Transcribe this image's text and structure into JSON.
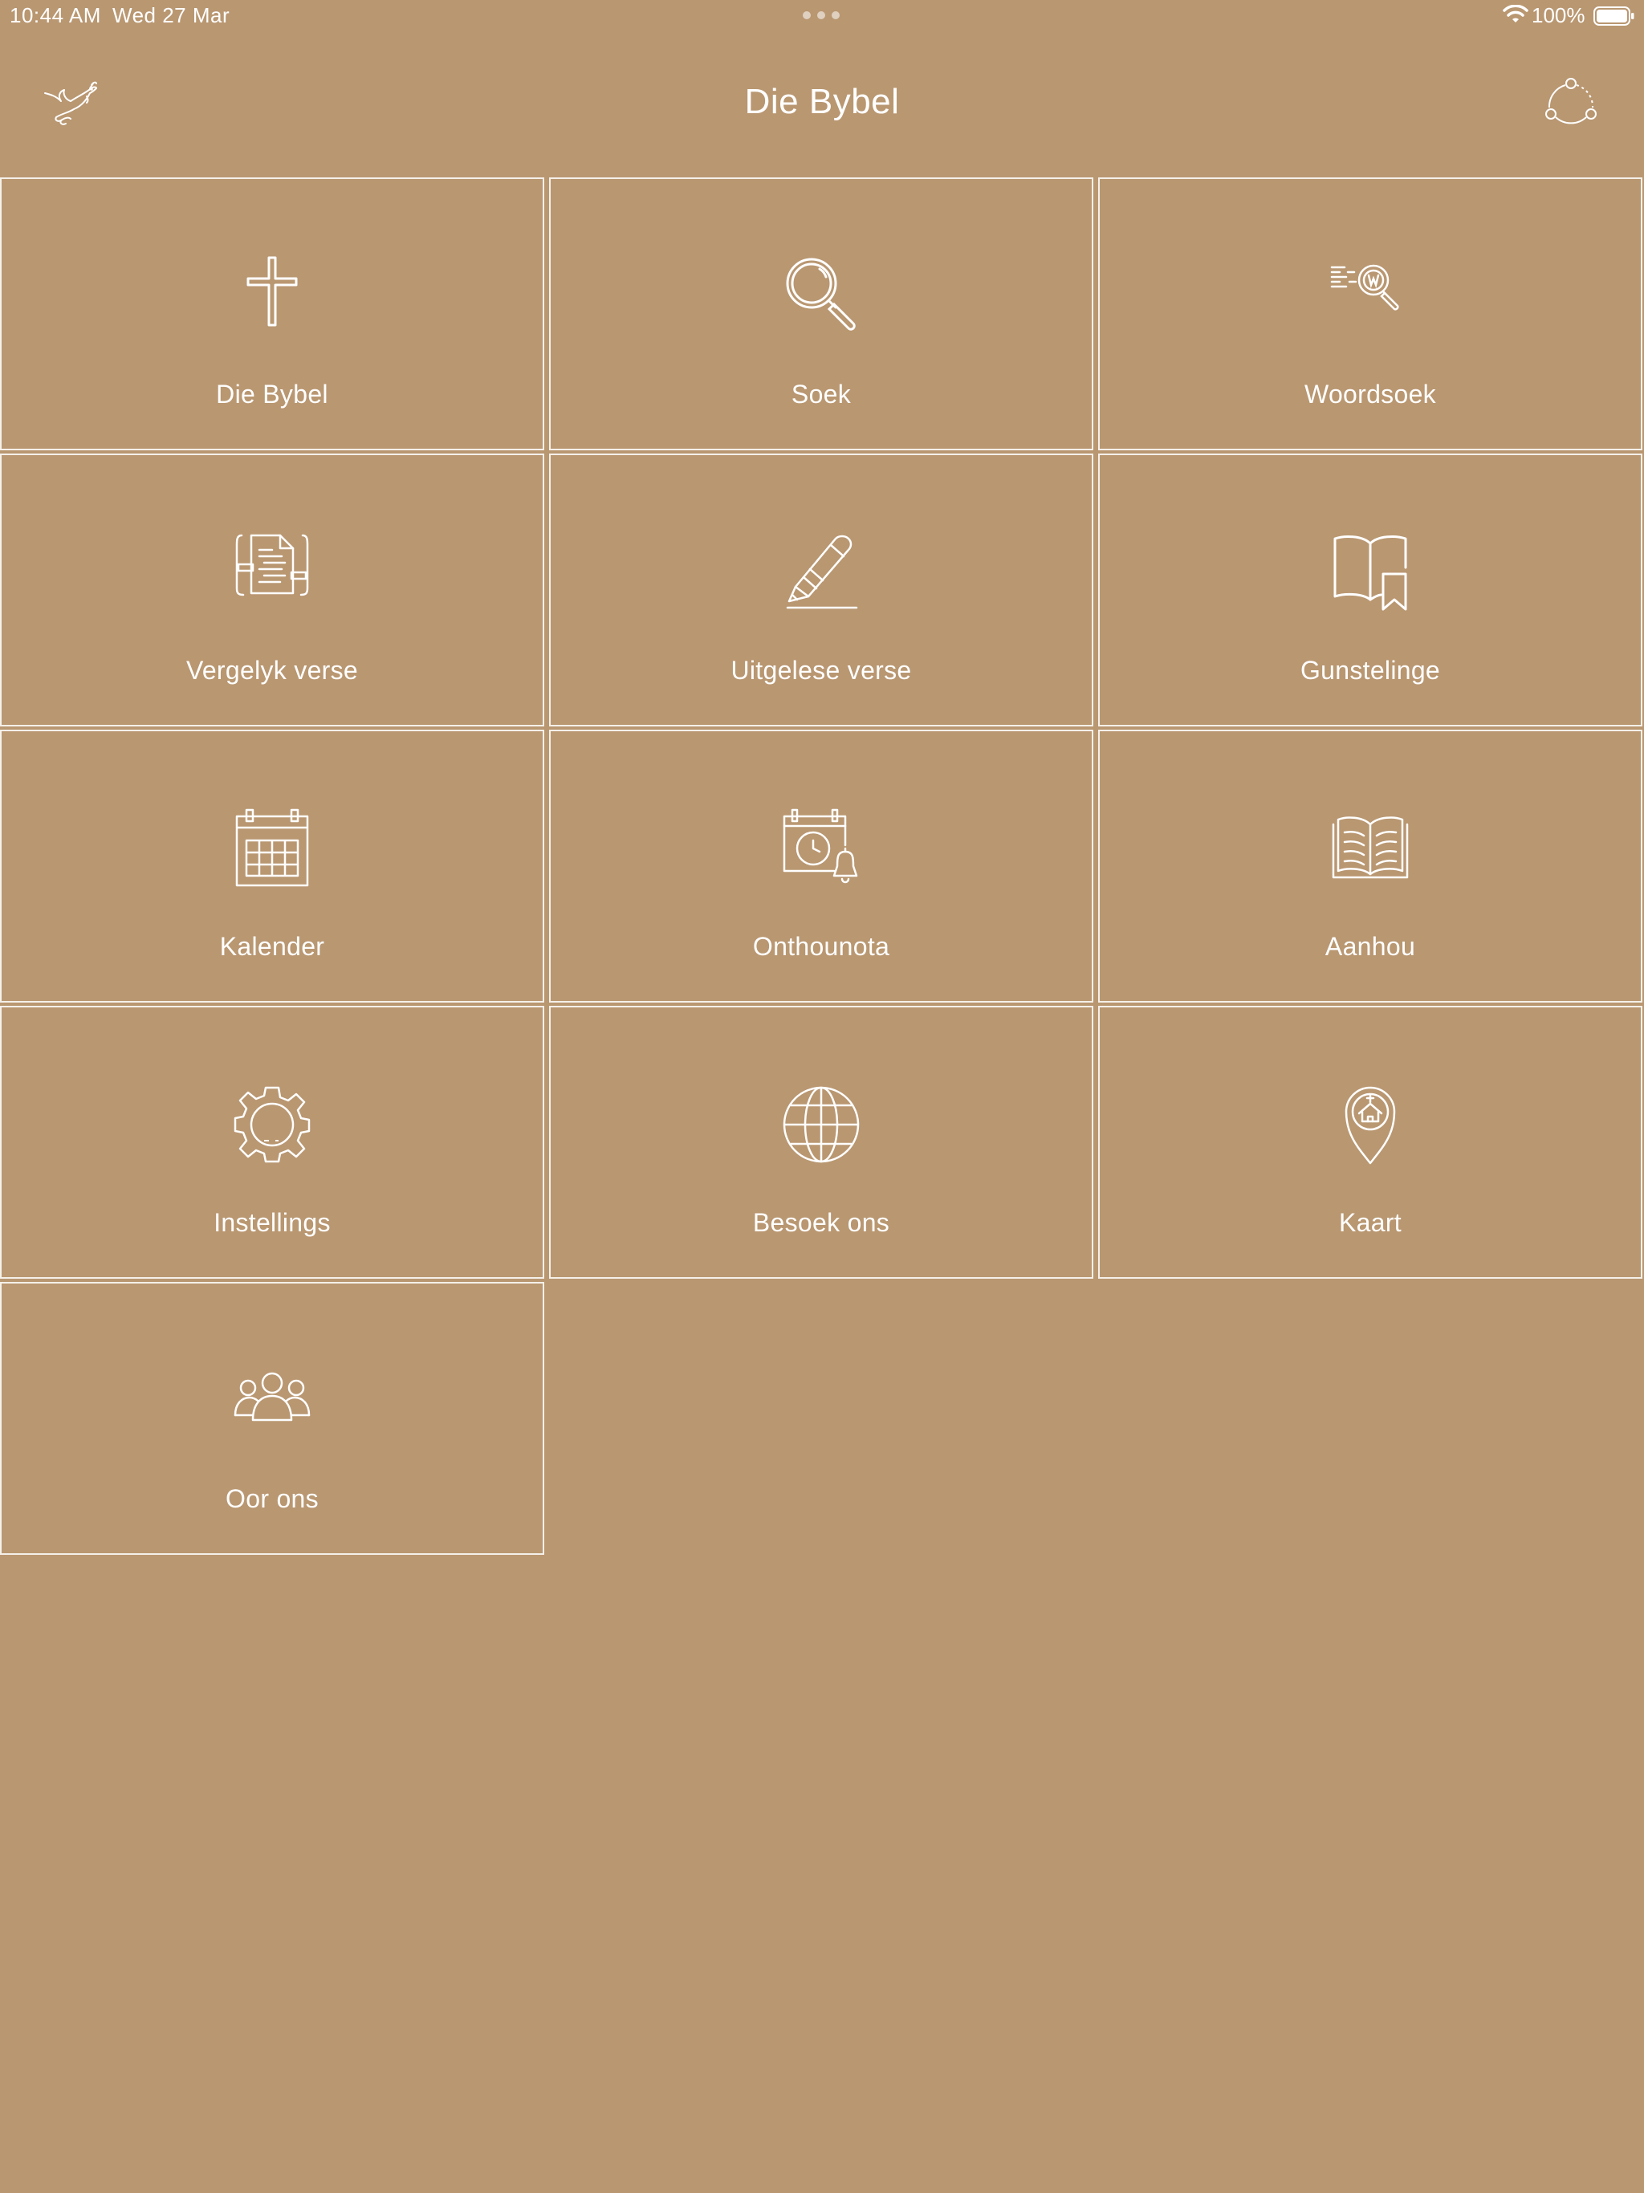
{
  "status_bar": {
    "time": "10:44 AM",
    "date": "Wed 27 Mar",
    "battery": "100%"
  },
  "header": {
    "title": "Die Bybel",
    "left_icon": "dove-icon",
    "right_icon": "share-icon"
  },
  "tiles": [
    {
      "label": "Die Bybel",
      "icon": "cross-icon"
    },
    {
      "label": "Soek",
      "icon": "search-icon"
    },
    {
      "label": "Woordsoek",
      "icon": "word-search-icon"
    },
    {
      "label": "Vergelyk verse",
      "icon": "compare-verses-icon"
    },
    {
      "label": "Uitgelese verse",
      "icon": "pencil-icon"
    },
    {
      "label": "Gunstelinge",
      "icon": "book-bookmark-icon"
    },
    {
      "label": "Kalender",
      "icon": "calendar-icon"
    },
    {
      "label": "Onthounota",
      "icon": "reminder-icon"
    },
    {
      "label": "Aanhou",
      "icon": "open-book-icon"
    },
    {
      "label": "Instellings",
      "icon": "gear-icon"
    },
    {
      "label": "Besoek ons",
      "icon": "globe-icon"
    },
    {
      "label": "Kaart",
      "icon": "map-pin-icon"
    },
    {
      "label": "Oor ons",
      "icon": "people-icon"
    }
  ],
  "colors": {
    "background": "#b99771",
    "foreground": "#ffffff"
  }
}
